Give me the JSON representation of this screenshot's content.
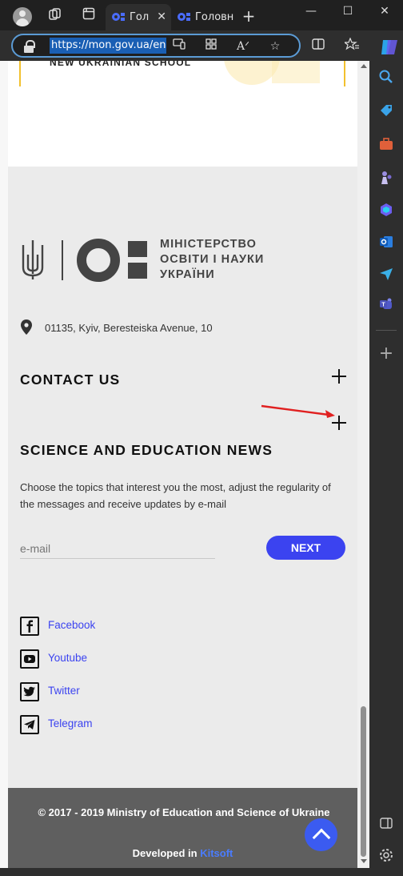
{
  "browser": {
    "tabs": [
      {
        "label": "Гол",
        "active": true
      },
      {
        "label": "Головн",
        "active": false
      }
    ],
    "url": "https://mon.gov.ua/eng",
    "new_tab_symbol": "+",
    "window_controls": {
      "minimize": "—",
      "maximize": "☐",
      "close": "✕"
    }
  },
  "page": {
    "banner_text": "NEW UKRAINIAN SCHOOL",
    "logo_lines": [
      "МІНІСТЕРСТВО",
      "ОСВІТИ І НАУКИ",
      "УКРАЇНИ"
    ],
    "address": "01135, Kyiv, Beresteiska Avenue, 10",
    "contact_title": "CONTACT US",
    "news_title": "SCIENCE AND EDUCATION NEWS",
    "news_desc": "Choose the topics that interest you the most, adjust the regularity of the messages and receive updates by e-mail",
    "email_placeholder": "e-mail",
    "next_label": "NEXT",
    "social": [
      {
        "label": "Facebook",
        "icon": "facebook-icon"
      },
      {
        "label": "Youtube",
        "icon": "youtube-icon"
      },
      {
        "label": "Twitter",
        "icon": "twitter-icon"
      },
      {
        "label": "Telegram",
        "icon": "telegram-icon"
      }
    ],
    "copyright": "© 2017 - 2019 Ministry of Education and Science of Ukraine",
    "developed_in": "Developed in",
    "developer": "Kitsoft"
  },
  "colors": {
    "accent": "#3b43f0",
    "footer_bg": "#ebebeb",
    "bottom_bar": "#5f5f5f",
    "annotation_arrow": "#e02020"
  }
}
